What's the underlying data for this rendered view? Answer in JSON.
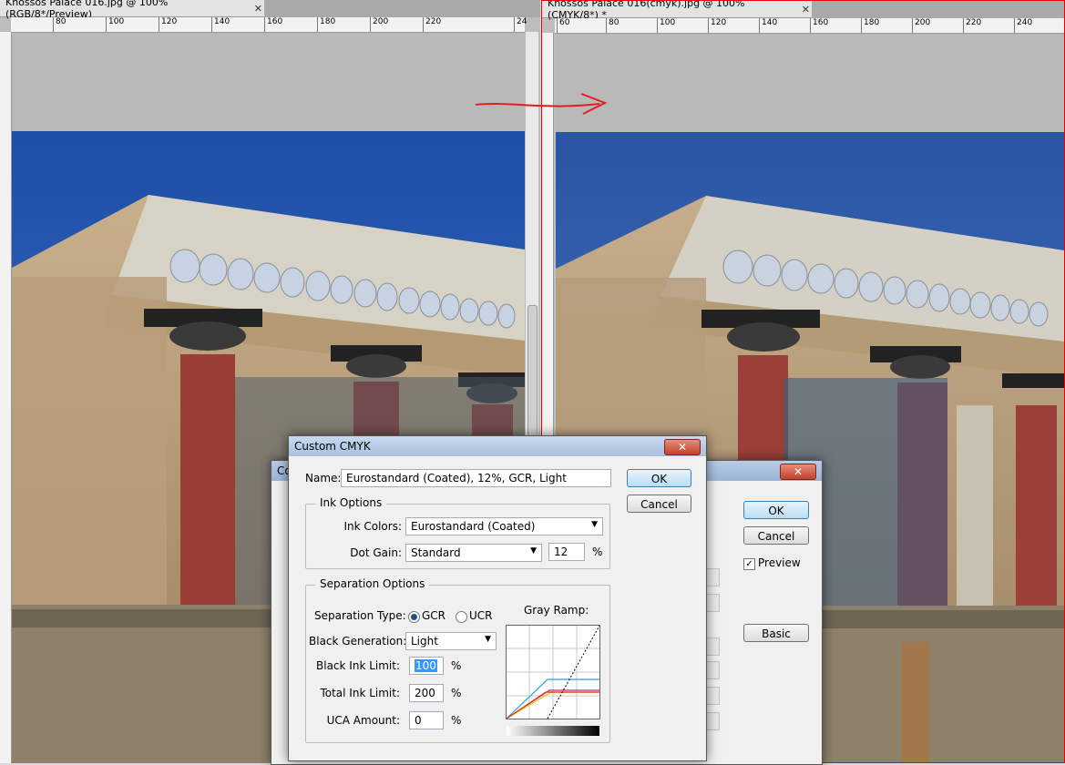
{
  "left_document": {
    "tab_title": "Knossos Palace 016.jpg @ 100% (RGB/8*/Preview)",
    "ruler_ticks": [
      "80",
      "100",
      "120",
      "140",
      "160",
      "180",
      "200",
      "220",
      "24"
    ]
  },
  "right_document": {
    "tab_title": "Knossos Palace 016(cmyk).jpg @ 100% (CMYK/8*) *",
    "ruler_ticks": [
      "60",
      "80",
      "100",
      "120",
      "140",
      "160",
      "180",
      "200",
      "220",
      "240"
    ]
  },
  "back_dialog": {
    "title_fragment": "Co",
    "ok_label": "OK",
    "cancel_label": "Cancel",
    "preview_label": "Preview",
    "preview_checked": true,
    "basic_label": "Basic"
  },
  "custom_cmyk": {
    "title": "Custom CMYK",
    "close_glyph": "x",
    "name_label": "Name:",
    "name_value": "Eurostandard (Coated), 12%, GCR, Light",
    "ok_label": "OK",
    "cancel_label": "Cancel",
    "ink_options_label": "Ink Options",
    "ink_colors_label": "Ink Colors:",
    "ink_colors_value": "Eurostandard (Coated)",
    "dot_gain_label": "Dot Gain:",
    "dot_gain_value": "Standard",
    "dot_gain_percent": "12",
    "percent_sign": "%",
    "separation_options_label": "Separation Options",
    "separation_type_label": "Separation Type:",
    "gcr_label": "GCR",
    "ucr_label": "UCR",
    "separation_type_selected": "GCR",
    "gray_ramp_label": "Gray Ramp:",
    "black_generation_label": "Black Generation:",
    "black_generation_value": "Light",
    "black_ink_limit_label": "Black Ink Limit:",
    "black_ink_limit_value": "100",
    "total_ink_limit_label": "Total Ink Limit:",
    "total_ink_limit_value": "200",
    "uca_amount_label": "UCA Amount:",
    "uca_amount_value": "0"
  },
  "colors": {
    "annotation_arrow": "#e02020",
    "sky": "#2a5fb8",
    "column_red": "#9a3d35",
    "ramp_cyan": "#1fa3d6",
    "ramp_magenta": "#d0217a",
    "ramp_yellow": "#e6c200",
    "ramp_red": "#e03010"
  }
}
